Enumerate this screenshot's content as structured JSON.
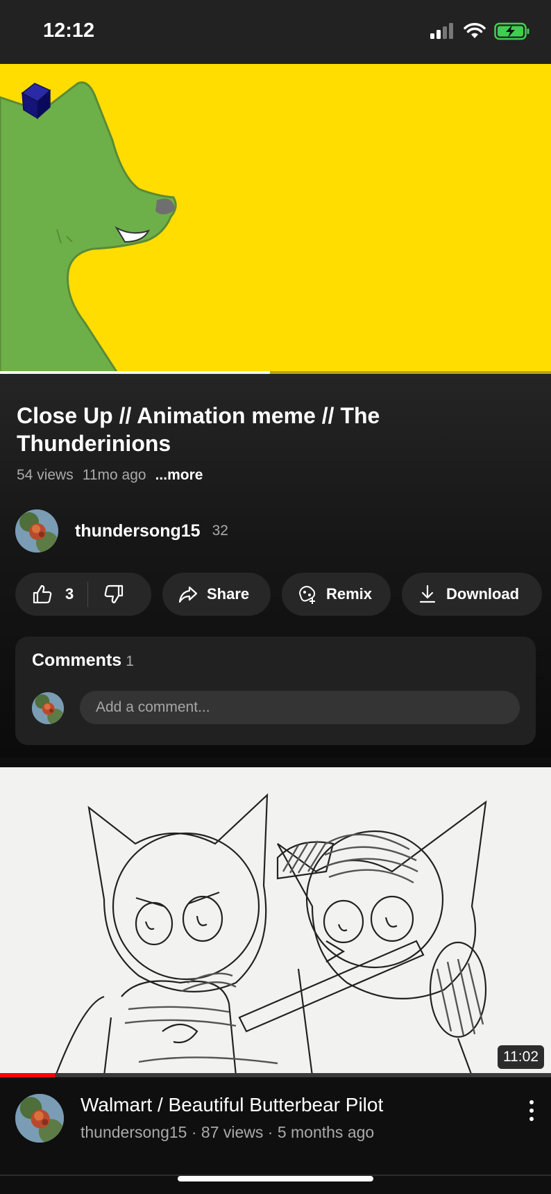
{
  "status_bar": {
    "time": "12:12"
  },
  "player": {
    "progress_fraction": 0.49,
    "colors": {
      "background": "#ffdd00",
      "figure": "#6db04a"
    }
  },
  "video": {
    "title": "Close Up // Animation meme // The Thunderinions",
    "views": "54 views",
    "age": "11mo ago",
    "more_label": "...more"
  },
  "channel": {
    "name": "thundersong15",
    "subscribers": "32"
  },
  "actions": {
    "likes": "3",
    "share_label": "Share",
    "remix_label": "Remix",
    "download_label": "Download"
  },
  "comments": {
    "heading": "Comments",
    "count": "1",
    "input_placeholder": "Add a comment..."
  },
  "next_video": {
    "duration": "11:02",
    "title": "Walmart / Beautiful Butterbear Pilot",
    "meta": "thundersong15 · 87 views · 5 months ago",
    "watched_fraction": 0.1
  }
}
